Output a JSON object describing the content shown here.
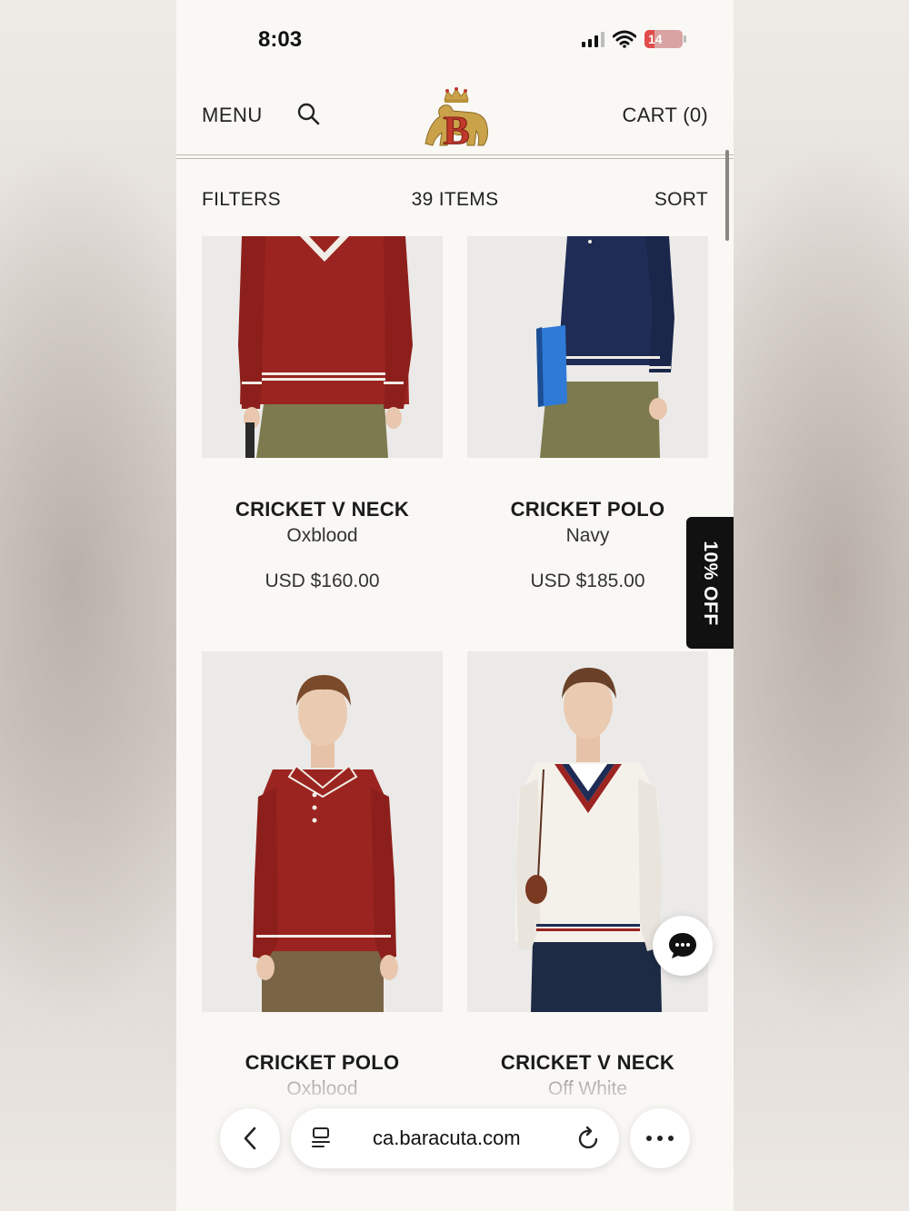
{
  "status_bar": {
    "time": "8:03",
    "battery": "14"
  },
  "header": {
    "menu_label": "MENU",
    "cart_label": "CART (0)"
  },
  "toolbar": {
    "filters_label": "FILTERS",
    "items_count": "39 ITEMS",
    "sort_label": "SORT"
  },
  "products": [
    {
      "name": "CRICKET V NECK",
      "color": "Oxblood",
      "price": "USD $160.00"
    },
    {
      "name": "CRICKET POLO",
      "color": "Navy",
      "price": "USD $185.00"
    },
    {
      "name": "CRICKET POLO",
      "color": "Oxblood"
    },
    {
      "name": "CRICKET V NECK",
      "color": "Off White"
    }
  ],
  "promo_tab": {
    "label": "10% OFF"
  },
  "browser": {
    "url": "ca.baracuta.com"
  },
  "icons": {
    "search": "search-icon",
    "logo": "baracuta-lion-logo",
    "chat": "chat-bubble-icon",
    "back": "chevron-left-icon",
    "reader": "reader-mode-icon",
    "reload": "reload-icon",
    "more": "ellipsis-icon"
  },
  "colors": {
    "page_bg": "#faf8f5",
    "text": "#1b1b1b",
    "promo_bg": "#111111",
    "oxblood": "#9b2420",
    "navy": "#1f2c55"
  }
}
